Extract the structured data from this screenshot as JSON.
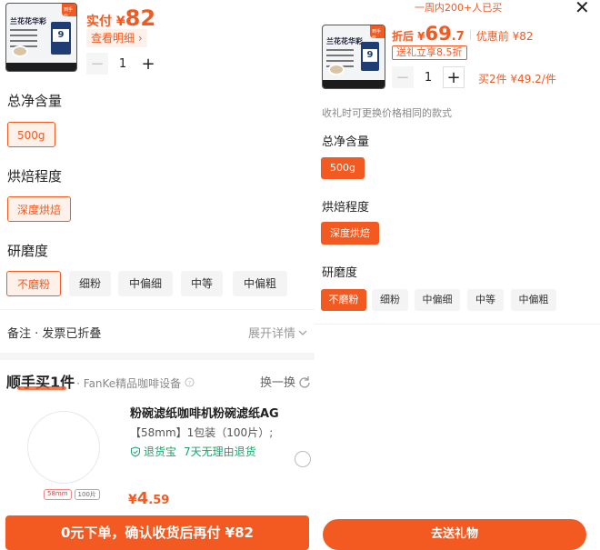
{
  "left": {
    "product": {
      "thumb_title": "兰花花华彩",
      "thumb_tag": "到手价",
      "bag_number": "9",
      "price_prefix": "实付 ¥",
      "price": "82",
      "detail_link": "查看明细 ›",
      "quantity": "1",
      "minus": "−",
      "plus": "+"
    },
    "net_content": {
      "label": "总净含量",
      "options": [
        "500g"
      ],
      "selected": "500g"
    },
    "roast": {
      "label": "烘焙程度",
      "options": [
        "深度烘焙"
      ],
      "selected": "深度烘焙"
    },
    "grind": {
      "label": "研磨度",
      "options": [
        "不磨粉",
        "细粉",
        "中偏细",
        "中等",
        "中偏粗"
      ],
      "selected": "不磨粉"
    },
    "remark": {
      "label": "备注 · 发票已折叠",
      "expand": "展开详情"
    },
    "bundle": {
      "title": "顺手买1件",
      "subtitle": "· FanKe精品咖啡设备",
      "swap": "换一换",
      "item_title": "粉碗滤纸咖啡机粉碗滤纸AG",
      "item_spec": "【58mm】1包装（100片）;",
      "guarantee_badge": "退货宝",
      "guarantee_text": "7天无理由退货",
      "size_label": "58mm",
      "count_label": "100片",
      "price_symbol": "¥",
      "price_int": "4",
      "price_dec": ".59"
    },
    "footer_button": "0元下单，确认收货后再付 ¥82"
  },
  "right": {
    "top_note": "一周内200+人已买",
    "close": "✕",
    "product": {
      "thumb_title": "兰花花华彩",
      "thumb_tag": "到手价",
      "bag_number": "9",
      "discount_prefix": "折后 ¥",
      "price_int": "69",
      "price_dec": ".7",
      "original_label": "优惠前 ¥82",
      "gift_badge": "送礼立享8.5折",
      "quantity": "1",
      "minus": "−",
      "plus": "+",
      "bulk_note": "买2件 ¥49.2/件"
    },
    "hint": "收礼时可更换价格相同的款式",
    "net_content": {
      "label": "总净含量",
      "options": [
        "500g"
      ],
      "selected": "500g"
    },
    "roast": {
      "label": "烘焙程度",
      "options": [
        "深度烘焙"
      ],
      "selected": "深度烘焙"
    },
    "grind": {
      "label": "研磨度",
      "options": [
        "不磨粉",
        "细粉",
        "中偏细",
        "中等",
        "中偏粗"
      ],
      "selected": "不磨粉"
    },
    "footer_button": "去送礼物"
  },
  "colors": {
    "accent": "#f25a22",
    "green": "#1aa36b"
  }
}
